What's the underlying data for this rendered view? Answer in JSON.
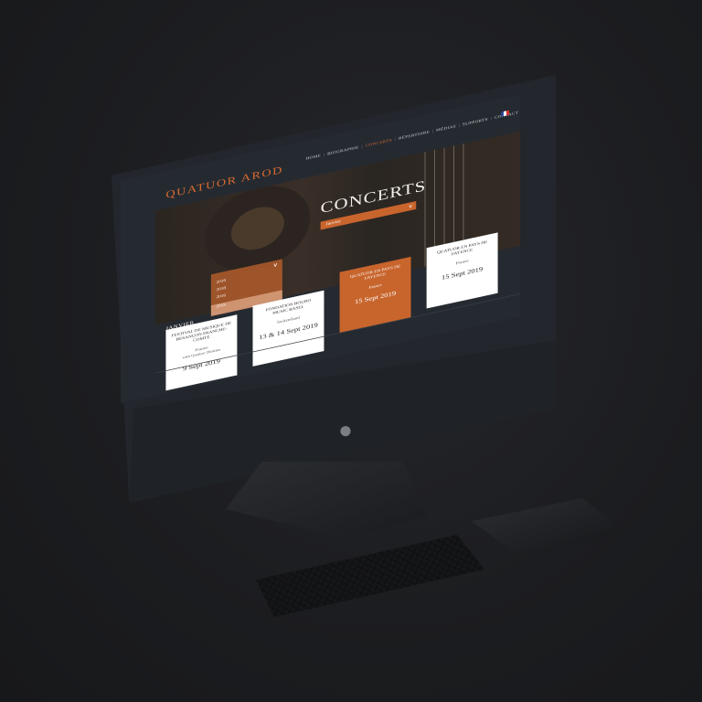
{
  "site": {
    "brand": "QUATUOR AROD",
    "nav": [
      {
        "label": "HOME",
        "active": false
      },
      {
        "label": "BIOGRAPHIE",
        "active": false
      },
      {
        "label": "CONCERTS",
        "active": true
      },
      {
        "label": "RÉPERTOIRE",
        "active": false
      },
      {
        "label": "MÉDIAS",
        "active": false
      },
      {
        "label": "SUPPORTS",
        "active": false
      },
      {
        "label": "CONTACT",
        "active": false
      }
    ],
    "page_title": "CONCERTS",
    "month_filter": {
      "selected": "Janvier"
    },
    "year_filter": {
      "options": [
        "2019",
        "2018",
        "2016",
        "2015"
      ]
    },
    "section_label": "JANVIER",
    "concerts": [
      {
        "title": "FESTIVAL DE MUSIQUE DE BESANÇON FRANCHE-COMTÉ",
        "place": "France",
        "extra": "with Quatuor Diotima",
        "date": "9 Sept 2019",
        "highlight": false
      },
      {
        "title": "FONDATION BOURO MUSIC BASEL",
        "place": "Switzerland",
        "extra": "",
        "date": "13 & 14 Sept 2019",
        "highlight": false
      },
      {
        "title": "QUATUOR EN PAYS DE FAYENCE",
        "place": "France",
        "extra": "",
        "date": "15 Sept 2019",
        "highlight": true
      },
      {
        "title": "QUATUOR EN PAYS DE FAYENCE",
        "place": "France",
        "extra": "",
        "date": "15 Sept 2019",
        "highlight": false
      }
    ]
  },
  "colors": {
    "accent": "#c8652d",
    "background": "#252a31"
  }
}
